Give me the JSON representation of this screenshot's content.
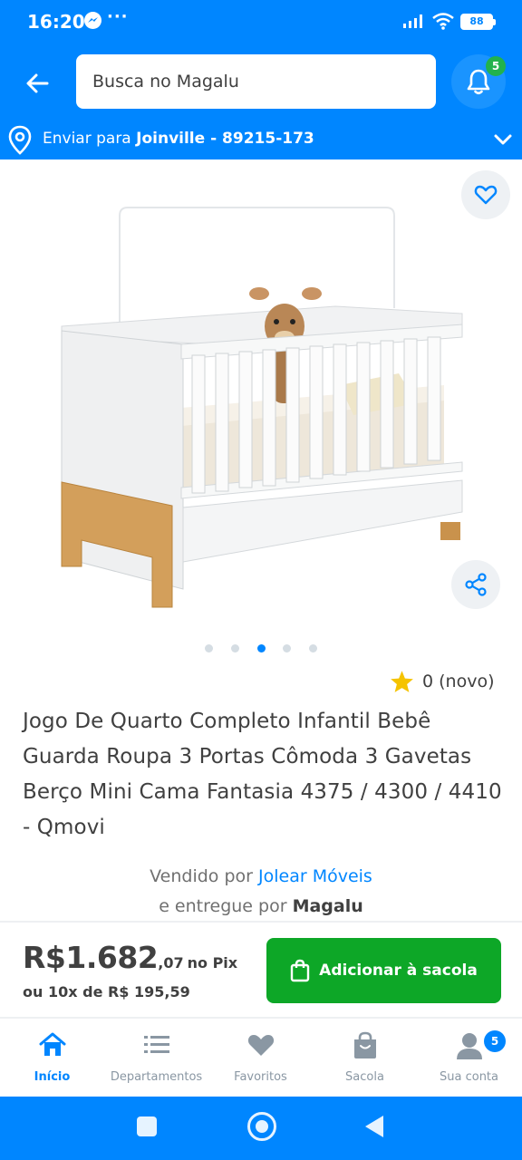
{
  "status_bar": {
    "time": "16:20",
    "dots": "···",
    "battery": "88",
    "icons": [
      "messenger-icon",
      "signal-icon",
      "wifi-icon",
      "battery-icon"
    ]
  },
  "header": {
    "search_placeholder": "Busca no Magalu",
    "notification_count": "5",
    "shipping_prefix": "Enviar para",
    "shipping_location": "Joinville - 89215-173"
  },
  "product": {
    "carousel_dot_count": 5,
    "carousel_active_index": 2,
    "rating_text": "0 (novo)",
    "title": "Jogo De Quarto Completo Infantil Bebê Guarda Roupa 3 Portas Cômoda 3 Gavetas Berço Mini Cama Fantasia 4375 / 4300 / 4410 - Qmovi",
    "sold_by_prefix": "Vendido por",
    "seller_name": "Jolear Móveis",
    "delivered_by_prefix": "e entregue por",
    "delivered_by": "Magalu"
  },
  "purchase": {
    "price_main": "R$1.682",
    "price_cents": ",07",
    "price_pix": "no Pix",
    "installments": "ou 10x de R$ 195,59",
    "add_button_label": "Adicionar à sacola"
  },
  "bottom_nav": {
    "items": [
      {
        "label": "Início",
        "icon": "home-icon",
        "active": true
      },
      {
        "label": "Departamentos",
        "icon": "list-icon",
        "active": false
      },
      {
        "label": "Favoritos",
        "icon": "heart-icon",
        "active": false
      },
      {
        "label": "Sacola",
        "icon": "bag-icon",
        "active": false
      },
      {
        "label": "Sua conta",
        "icon": "user-icon",
        "active": false
      }
    ],
    "account_badge": "5"
  },
  "colors": {
    "brand_blue": "#0086ff",
    "add_button_green": "#0da727",
    "badge_green": "#22b24c",
    "text": "#404040"
  }
}
